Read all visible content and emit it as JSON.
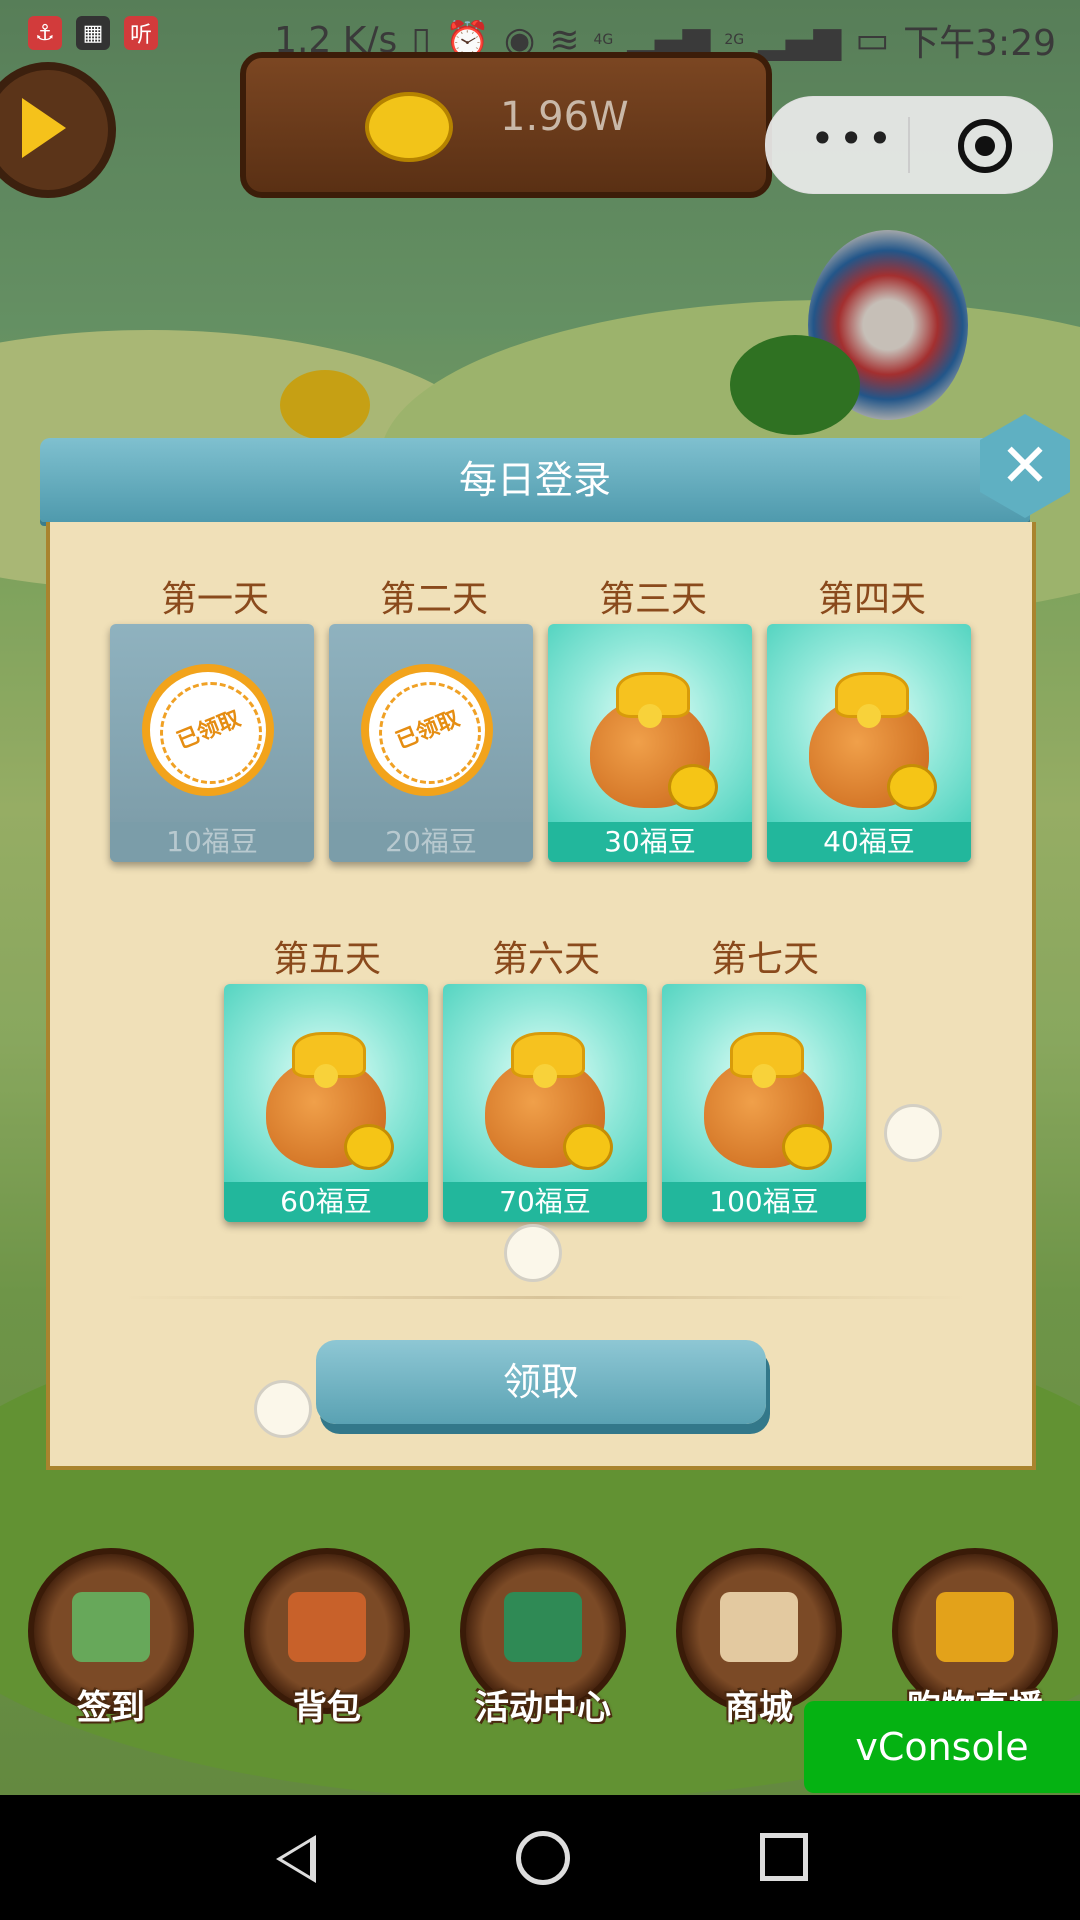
{
  "status_bar": {
    "speed": "1.2 K/s",
    "signal_4g": "4G",
    "signal_2g": "2G",
    "time": "下午3:29",
    "app_icon_text": "听"
  },
  "game": {
    "coin_balance": "1.96W"
  },
  "mini_program_capsule": {
    "more_icon": "more-dots-icon",
    "close_icon": "target-icon"
  },
  "dialog": {
    "title": "每日登录",
    "days": [
      {
        "label": "第一天",
        "amount": "10福豆",
        "status": "claimed",
        "stamp_text": "已领取"
      },
      {
        "label": "第二天",
        "amount": "20福豆",
        "status": "claimed",
        "stamp_text": "已领取"
      },
      {
        "label": "第三天",
        "amount": "30福豆",
        "status": "available"
      },
      {
        "label": "第四天",
        "amount": "40福豆",
        "status": "available"
      },
      {
        "label": "第五天",
        "amount": "60福豆",
        "status": "available"
      },
      {
        "label": "第六天",
        "amount": "70福豆",
        "status": "available"
      },
      {
        "label": "第七天",
        "amount": "100福豆",
        "status": "available"
      }
    ],
    "claim_button": "领取"
  },
  "bottom_nav": [
    {
      "label": "签到",
      "icon": "map-icon"
    },
    {
      "label": "背包",
      "icon": "backpack-icon"
    },
    {
      "label": "活动中心",
      "icon": "book-icon"
    },
    {
      "label": "商城",
      "icon": "shop-icon"
    },
    {
      "label": "购物直播",
      "icon": "tv-icon"
    }
  ],
  "vconsole": {
    "label": "vConsole"
  },
  "colors": {
    "accent_teal": "#22b79c",
    "dialog_header": "#5fb0c2",
    "vconsole_green": "#05b212"
  }
}
